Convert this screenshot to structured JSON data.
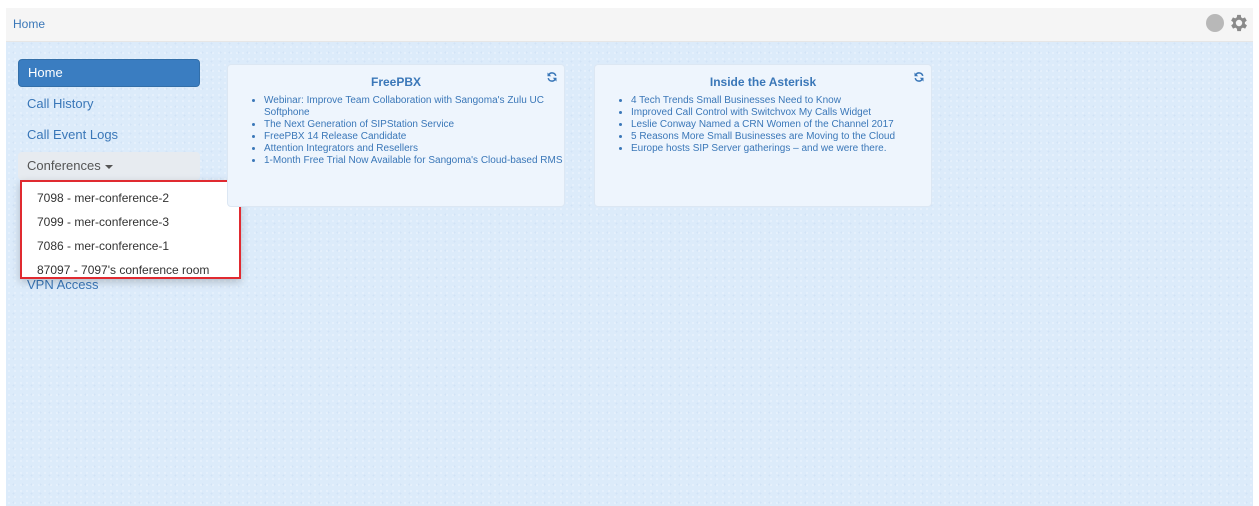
{
  "topbar": {
    "breadcrumb": "Home",
    "status_icon": "status-circle-icon",
    "settings_icon": "gear-icon"
  },
  "sidebar": {
    "items": [
      {
        "label": "Home",
        "active": true
      },
      {
        "label": "Call History"
      },
      {
        "label": "Call Event Logs"
      },
      {
        "label": "Conferences"
      }
    ],
    "vpn_label": "VPN Access"
  },
  "conference_menu": {
    "items": [
      "7098 - mer-conference-2",
      "7099 - mer-conference-3",
      "7086 - mer-conference-1",
      "87097 - 7097's conference room"
    ]
  },
  "widgets": [
    {
      "title": "FreePBX",
      "items": [
        "Webinar: Improve Team Collaboration with Sangoma's Zulu UC Softphone",
        "The Next Generation of SIPStation Service",
        "FreePBX 14 Release Candidate",
        "Attention Integrators and Resellers",
        "1-Month Free Trial Now Available for Sangoma's Cloud-based RMS"
      ]
    },
    {
      "title": "Inside the Asterisk",
      "items": [
        "4 Tech Trends Small Businesses Need to Know",
        "Improved Call Control with Switchvox My Calls Widget",
        "Leslie Conway Named a CRN Women of the Channel 2017",
        "5 Reasons More Small Businesses are Moving to the Cloud",
        "Europe hosts SIP Server gatherings – and we were there."
      ]
    }
  ],
  "colors": {
    "link": "#3a77b8",
    "active_nav": "#3a7dc1",
    "background": "#dcebfa",
    "highlight_border": "#e02a30"
  }
}
